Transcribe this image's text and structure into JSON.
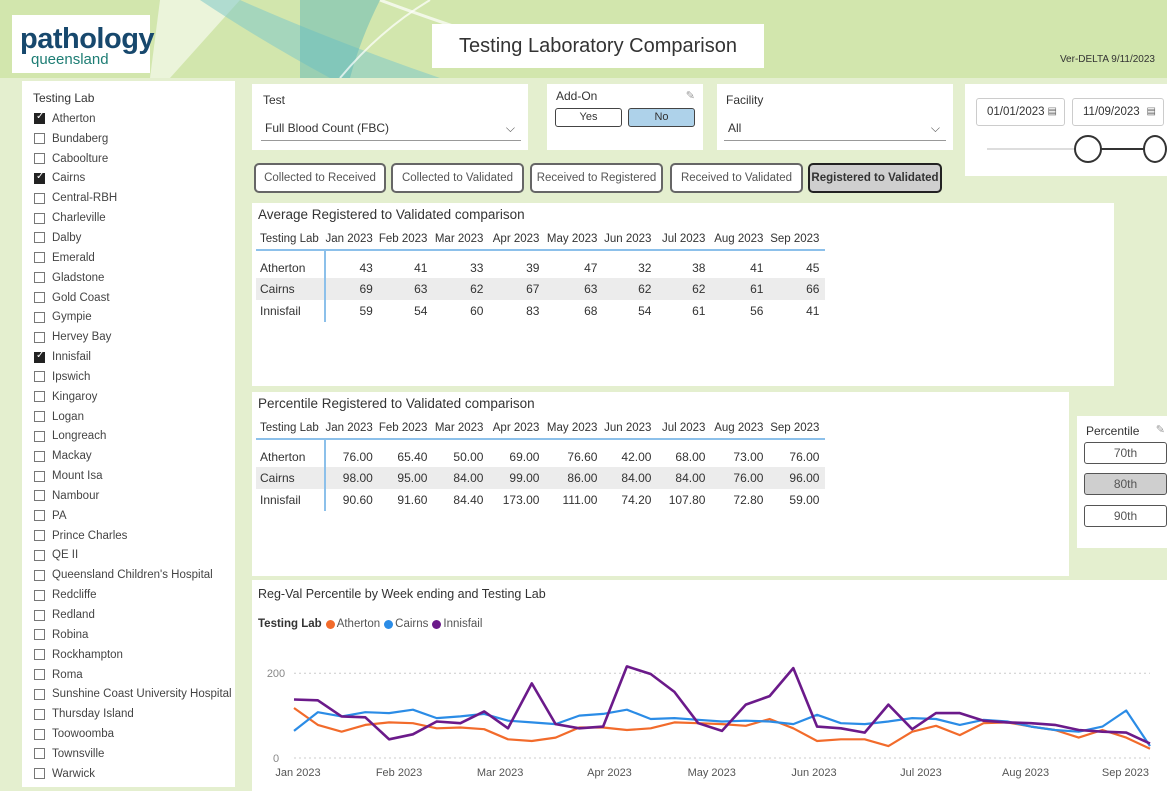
{
  "header": {
    "logo_main": "pathology",
    "logo_sub": "queensland",
    "title": "Testing Laboratory Comparison",
    "version": "Ver-DELTA 9/11/2023"
  },
  "sidebar": {
    "title": "Testing Lab",
    "labs": [
      {
        "name": "Atherton",
        "checked": true
      },
      {
        "name": "Bundaberg",
        "checked": false
      },
      {
        "name": "Caboolture",
        "checked": false
      },
      {
        "name": "Cairns",
        "checked": true
      },
      {
        "name": "Central-RBH",
        "checked": false
      },
      {
        "name": "Charleville",
        "checked": false
      },
      {
        "name": "Dalby",
        "checked": false
      },
      {
        "name": "Emerald",
        "checked": false
      },
      {
        "name": "Gladstone",
        "checked": false
      },
      {
        "name": "Gold Coast",
        "checked": false
      },
      {
        "name": "Gympie",
        "checked": false
      },
      {
        "name": "Hervey Bay",
        "checked": false
      },
      {
        "name": "Innisfail",
        "checked": true
      },
      {
        "name": "Ipswich",
        "checked": false
      },
      {
        "name": "Kingaroy",
        "checked": false
      },
      {
        "name": "Logan",
        "checked": false
      },
      {
        "name": "Longreach",
        "checked": false
      },
      {
        "name": "Mackay",
        "checked": false
      },
      {
        "name": "Mount Isa",
        "checked": false
      },
      {
        "name": "Nambour",
        "checked": false
      },
      {
        "name": "PA",
        "checked": false
      },
      {
        "name": "Prince Charles",
        "checked": false
      },
      {
        "name": "QE II",
        "checked": false
      },
      {
        "name": "Queensland Children's Hospital",
        "checked": false
      },
      {
        "name": "Redcliffe",
        "checked": false
      },
      {
        "name": "Redland",
        "checked": false
      },
      {
        "name": "Robina",
        "checked": false
      },
      {
        "name": "Rockhampton",
        "checked": false
      },
      {
        "name": "Roma",
        "checked": false
      },
      {
        "name": "Sunshine Coast University Hospital",
        "checked": false
      },
      {
        "name": "Thursday Island",
        "checked": false
      },
      {
        "name": "Toowoomba",
        "checked": false
      },
      {
        "name": "Townsville",
        "checked": false
      },
      {
        "name": "Warwick",
        "checked": false
      }
    ]
  },
  "filters": {
    "test_label": "Test",
    "test_value": "Full Blood Count (FBC)",
    "addon_label": "Add-On",
    "addon_yes": "Yes",
    "addon_no": "No",
    "addon_selected": "No",
    "facility_label": "Facility",
    "facility_value": "All",
    "date_from": "01/01/2023",
    "date_to": "11/09/2023"
  },
  "tabs": [
    {
      "label": "Collected to Received",
      "active": false
    },
    {
      "label": "Collected to Validated",
      "active": false
    },
    {
      "label": "Received to Registered",
      "active": false
    },
    {
      "label": "Received to Validated",
      "active": false
    },
    {
      "label": "Registered to Validated",
      "active": true
    }
  ],
  "avg_table": {
    "title": "Average Registered to Validated comparison",
    "headers": [
      "Testing Lab",
      "Jan 2023",
      "Feb 2023",
      "Mar 2023",
      "Apr 2023",
      "May 2023",
      "Jun 2023",
      "Jul 2023",
      "Aug 2023",
      "Sep 2023"
    ],
    "rows": [
      [
        "Atherton",
        "43",
        "41",
        "33",
        "39",
        "47",
        "32",
        "38",
        "41",
        "45"
      ],
      [
        "Cairns",
        "69",
        "63",
        "62",
        "67",
        "63",
        "62",
        "62",
        "61",
        "66"
      ],
      [
        "Innisfail",
        "59",
        "54",
        "60",
        "83",
        "68",
        "54",
        "61",
        "56",
        "41"
      ]
    ]
  },
  "pct_table": {
    "title": "Percentile Registered to Validated comparison",
    "headers": [
      "Testing Lab",
      "Jan 2023",
      "Feb 2023",
      "Mar 2023",
      "Apr 2023",
      "May 2023",
      "Jun 2023",
      "Jul 2023",
      "Aug 2023",
      "Sep 2023"
    ],
    "rows": [
      [
        "Atherton",
        "76.00",
        "65.40",
        "50.00",
        "69.00",
        "76.60",
        "42.00",
        "68.00",
        "73.00",
        "76.00"
      ],
      [
        "Cairns",
        "98.00",
        "95.00",
        "84.00",
        "99.00",
        "86.00",
        "84.00",
        "84.00",
        "76.00",
        "96.00"
      ],
      [
        "Innisfail",
        "90.60",
        "91.60",
        "84.40",
        "173.00",
        "111.00",
        "74.20",
        "107.80",
        "72.80",
        "59.00"
      ]
    ]
  },
  "percentile": {
    "title": "Percentile",
    "options": [
      "70th",
      "80th",
      "90th"
    ],
    "selected": "80th"
  },
  "chart": {
    "title": "Reg-Val Percentile by Week ending and Testing Lab",
    "legend_title": "Testing Lab"
  },
  "colors": {
    "Atherton": "#f26b2b",
    "Cairns": "#2b8ce6",
    "Innisfail": "#6b1a8a"
  },
  "chart_data": {
    "type": "line",
    "title": "Reg-Val Percentile by Week ending and Testing Lab",
    "xlabel": "",
    "ylabel": "",
    "ylim": [
      0,
      250
    ],
    "y_ticks": [
      0,
      200
    ],
    "x_tick_labels": [
      "Jan 2023",
      "Feb 2023",
      "Mar 2023",
      "Apr 2023",
      "May 2023",
      "Jun 2023",
      "Jul 2023",
      "Aug 2023",
      "Sep 2023"
    ],
    "legend": "top-left",
    "series": [
      {
        "name": "Atherton",
        "values": [
          118,
          78,
          62,
          78,
          84,
          82,
          70,
          72,
          68,
          44,
          40,
          48,
          72,
          72,
          66,
          70,
          84,
          82,
          80,
          76,
          92,
          70,
          40,
          44,
          44,
          28,
          62,
          76,
          54,
          82,
          84,
          74,
          66,
          48,
          66,
          48,
          22
        ]
      },
      {
        "name": "Cairns",
        "values": [
          64,
          108,
          98,
          108,
          106,
          114,
          94,
          98,
          104,
          88,
          84,
          80,
          100,
          104,
          114,
          92,
          94,
          90,
          86,
          88,
          86,
          80,
          102,
          82,
          80,
          86,
          94,
          92,
          78,
          90,
          86,
          74,
          66,
          62,
          74,
          112,
          28
        ]
      },
      {
        "name": "Innisfail",
        "values": [
          138,
          136,
          98,
          96,
          44,
          56,
          86,
          82,
          110,
          70,
          176,
          80,
          70,
          74,
          216,
          198,
          156,
          82,
          64,
          126,
          146,
          212,
          74,
          70,
          60,
          126,
          68,
          106,
          106,
          88,
          84,
          82,
          78,
          66,
          62,
          60,
          34
        ]
      }
    ]
  }
}
